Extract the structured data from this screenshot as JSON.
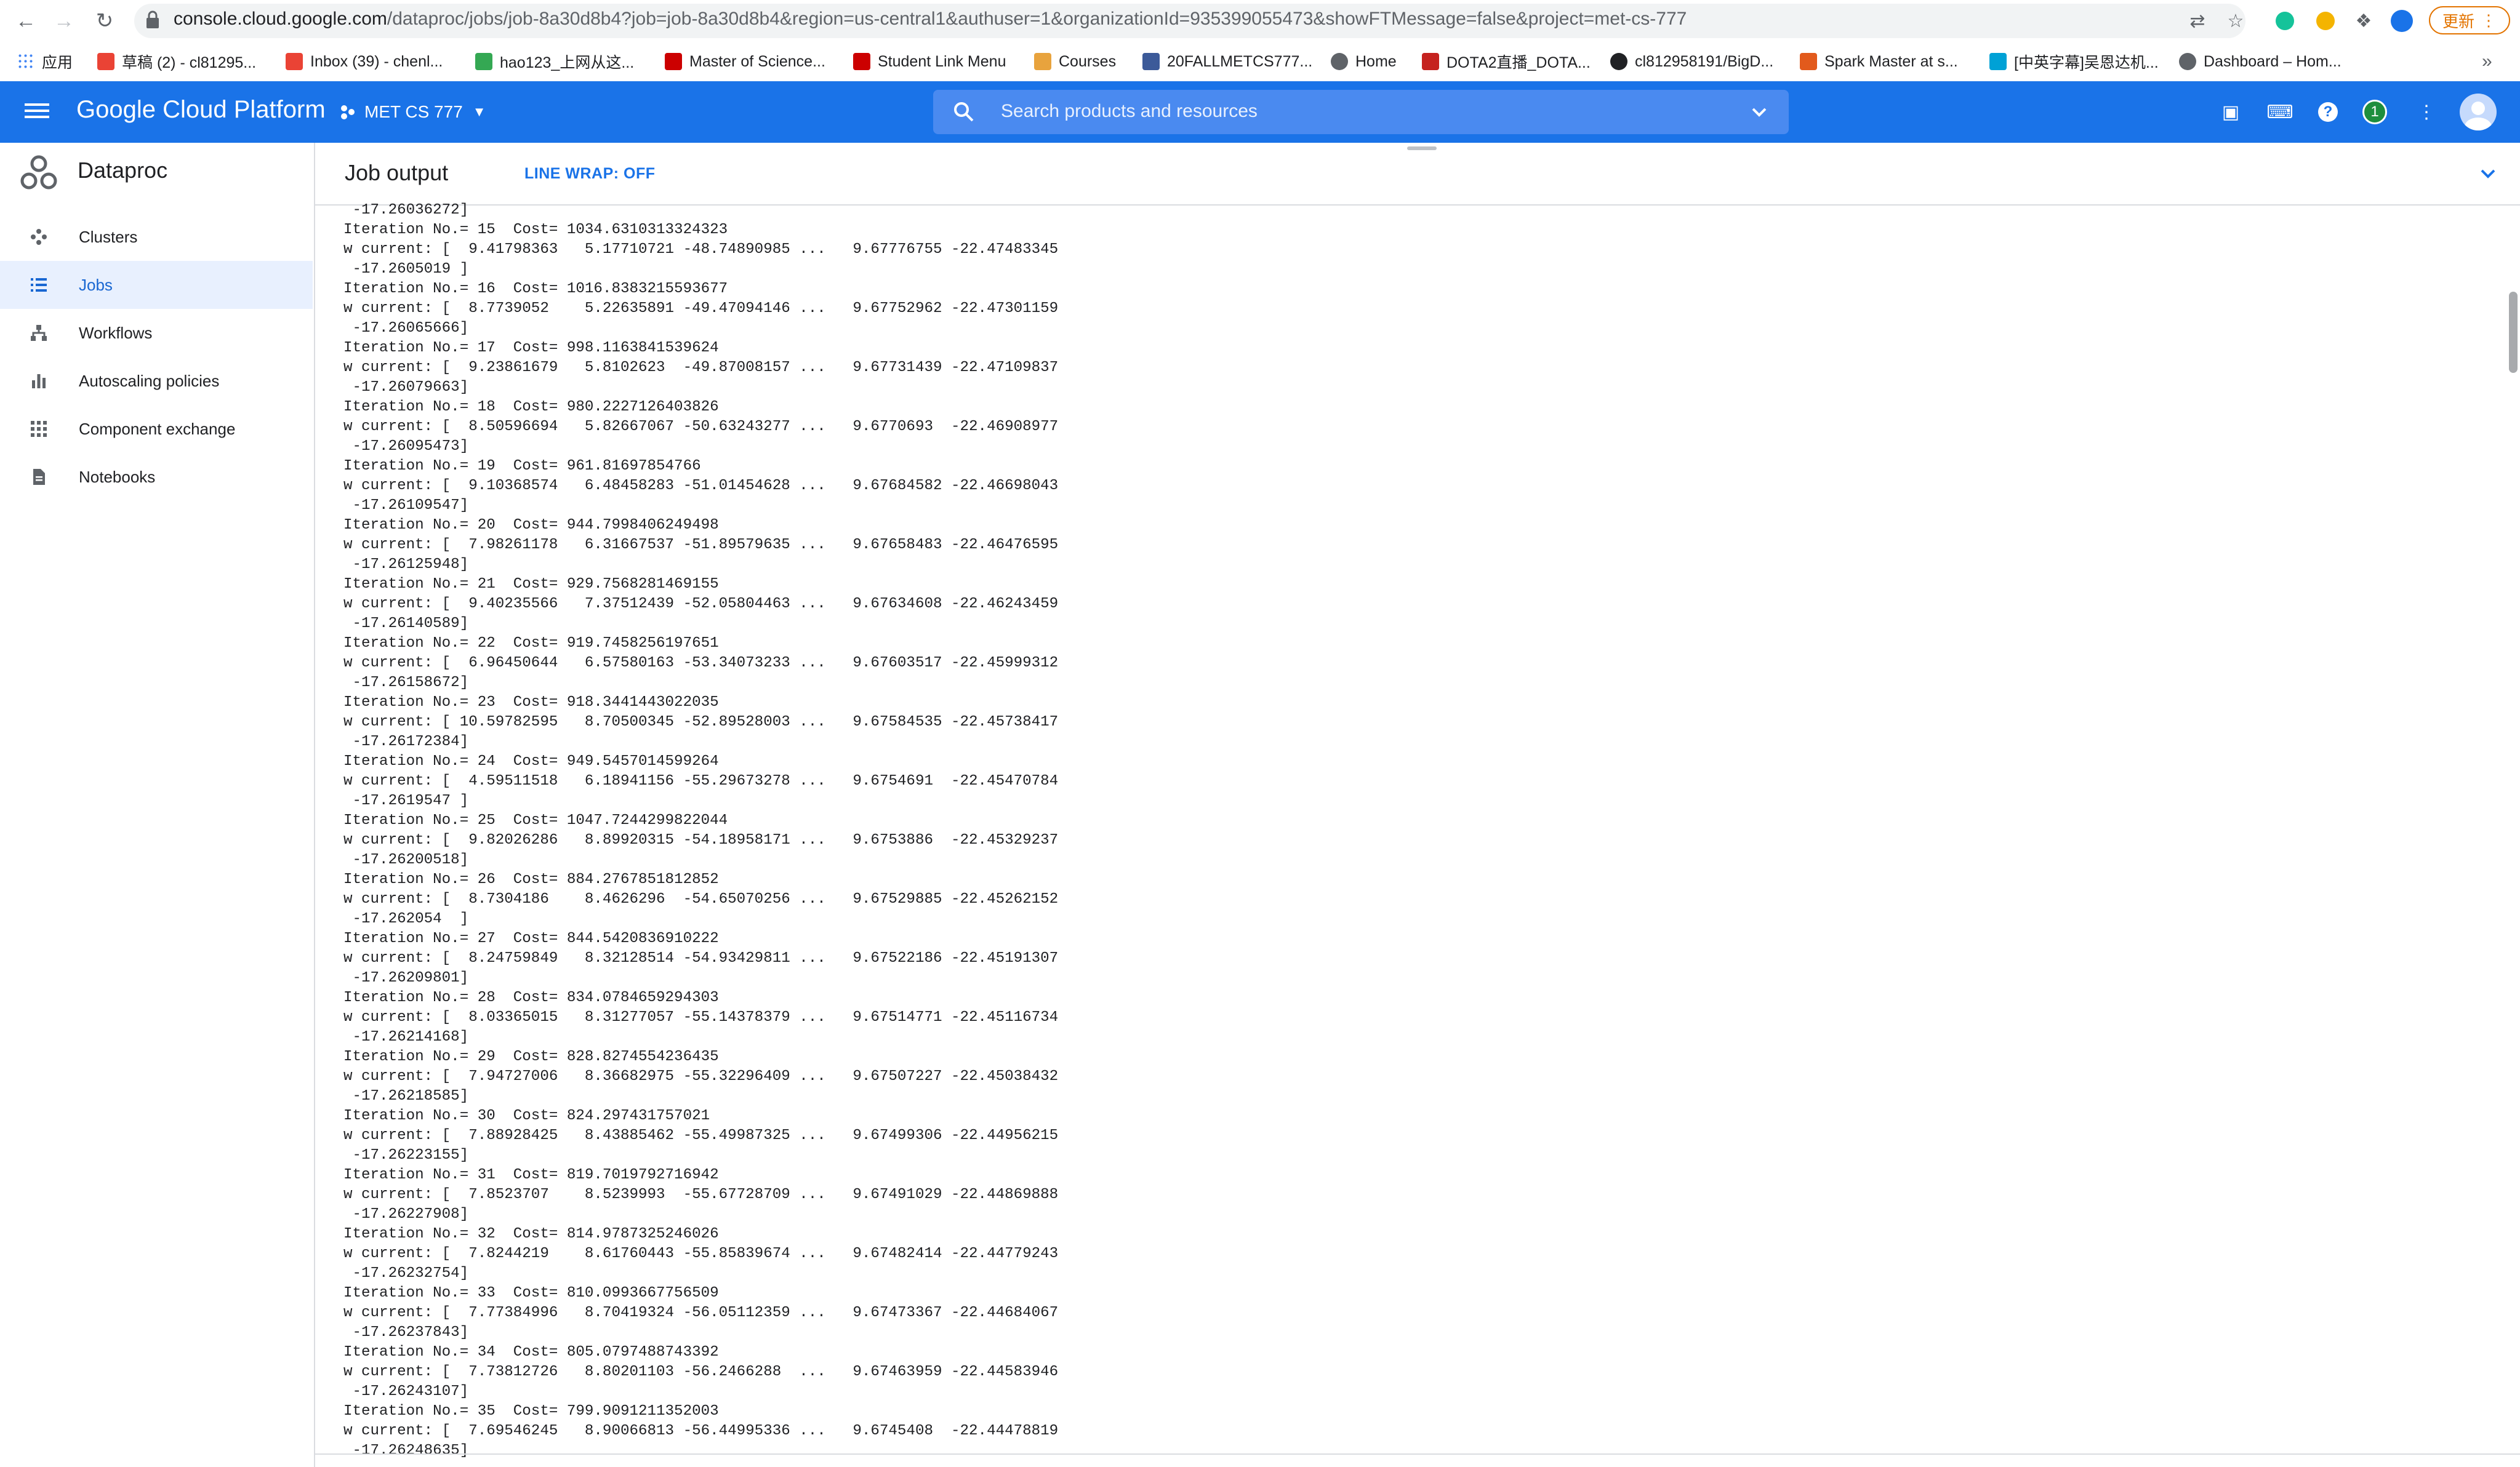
{
  "browser": {
    "url_host": "console.cloud.google.com",
    "url_rest": "/dataproc/jobs/job-8a30d8b4?job=job-8a30d8b4&region=us-central1&authuser=1&organizationId=935399055473&showFTMessage=false&project=met-cs-777",
    "update_label": "更新"
  },
  "bookmarks": [
    {
      "label": "应用",
      "color": "#4285f4"
    },
    {
      "label": "草稿 (2) - cl81295...",
      "color": "#ea4335"
    },
    {
      "label": "Inbox (39) - chenl...",
      "color": "#ea4335"
    },
    {
      "label": "hao123_上网从这...",
      "color": "#34a853"
    },
    {
      "label": "Master of Science...",
      "color": "#cc0000"
    },
    {
      "label": "Student Link Menu",
      "color": "#cc0000"
    },
    {
      "label": "Courses",
      "color": "#e8a33d"
    },
    {
      "label": "20FALLMETCS777...",
      "color": "#3c5a99"
    },
    {
      "label": "Home",
      "color": "#5f6368"
    },
    {
      "label": "DOTA2直播_DOTA...",
      "color": "#c5221f"
    },
    {
      "label": "cl812958191/BigD...",
      "color": "#202124"
    },
    {
      "label": "Spark Master at s...",
      "color": "#e25a1c"
    },
    {
      "label": "[中英字幕]吴恩达机...",
      "color": "#00a1d6"
    },
    {
      "label": "Dashboard – Hom...",
      "color": "#5f6368"
    }
  ],
  "header": {
    "title": "Google Cloud Platform",
    "project": "MET CS 777",
    "search_placeholder": "Search products and resources",
    "notifications": "1"
  },
  "sidebar": {
    "product": "Dataproc",
    "items": [
      {
        "label": "Clusters",
        "icon": "clusters-icon"
      },
      {
        "label": "Jobs",
        "icon": "jobs-icon"
      },
      {
        "label": "Workflows",
        "icon": "workflows-icon"
      },
      {
        "label": "Autoscaling policies",
        "icon": "autoscaling-icon"
      },
      {
        "label": "Component exchange",
        "icon": "component-exchange-icon"
      },
      {
        "label": "Notebooks",
        "icon": "notebooks-icon"
      }
    ]
  },
  "job_output": {
    "title": "Job output",
    "line_wrap": "LINE WRAP: OFF",
    "log_lines": [
      " -17.26036272]",
      "Iteration No.= 15  Cost= 1034.6310313324323",
      "w current: [  9.41798363   5.17710721 -48.74890985 ...   9.67776755 -22.47483345",
      " -17.2605019 ]",
      "Iteration No.= 16  Cost= 1016.8383215593677",
      "w current: [  8.7739052    5.22635891 -49.47094146 ...   9.67752962 -22.47301159",
      " -17.26065666]",
      "Iteration No.= 17  Cost= 998.1163841539624",
      "w current: [  9.23861679   5.8102623  -49.87008157 ...   9.67731439 -22.47109837",
      " -17.26079663]",
      "Iteration No.= 18  Cost= 980.2227126403826",
      "w current: [  8.50596694   5.82667067 -50.63243277 ...   9.6770693  -22.46908977",
      " -17.26095473]",
      "Iteration No.= 19  Cost= 961.81697854766",
      "w current: [  9.10368574   6.48458283 -51.01454628 ...   9.67684582 -22.46698043",
      " -17.26109547]",
      "Iteration No.= 20  Cost= 944.7998406249498",
      "w current: [  7.98261178   6.31667537 -51.89579635 ...   9.67658483 -22.46476595",
      " -17.26125948]",
      "Iteration No.= 21  Cost= 929.7568281469155",
      "w current: [  9.40235566   7.37512439 -52.05804463 ...   9.67634608 -22.46243459",
      " -17.26140589]",
      "Iteration No.= 22  Cost= 919.7458256197651",
      "w current: [  6.96450644   6.57580163 -53.34073233 ...   9.67603517 -22.45999312",
      " -17.26158672]",
      "Iteration No.= 23  Cost= 918.3441443022035",
      "w current: [ 10.59782595   8.70500345 -52.89528003 ...   9.67584535 -22.45738417",
      " -17.26172384]",
      "Iteration No.= 24  Cost= 949.5457014599264",
      "w current: [  4.59511518   6.18941156 -55.29673278 ...   9.6754691  -22.45470784",
      " -17.2619547 ]",
      "Iteration No.= 25  Cost= 1047.7244299822044",
      "w current: [  9.82026286   8.89920315 -54.18958171 ...   9.6753886  -22.45329237",
      " -17.26200518]",
      "Iteration No.= 26  Cost= 884.2767851812852",
      "w current: [  8.7304186    8.4626296  -54.65070256 ...   9.67529885 -22.45262152",
      " -17.262054  ]",
      "Iteration No.= 27  Cost= 844.5420836910222",
      "w current: [  8.24759849   8.32128514 -54.93429811 ...   9.67522186 -22.45191307",
      " -17.26209801]",
      "Iteration No.= 28  Cost= 834.0784659294303",
      "w current: [  8.03365015   8.31277057 -55.14378379 ...   9.67514771 -22.45116734",
      " -17.26214168]",
      "Iteration No.= 29  Cost= 828.8274554236435",
      "w current: [  7.94727006   8.36682975 -55.32296409 ...   9.67507227 -22.45038432",
      " -17.26218585]",
      "Iteration No.= 30  Cost= 824.297431757021",
      "w current: [  7.88928425   8.43885462 -55.49987325 ...   9.67499306 -22.44956215",
      " -17.26223155]",
      "Iteration No.= 31  Cost= 819.7019792716942",
      "w current: [  7.8523707    8.5239993  -55.67728709 ...   9.67491029 -22.44869888",
      " -17.26227908]",
      "Iteration No.= 32  Cost= 814.9787325246026",
      "w current: [  7.8244219    8.61760443 -55.85839674 ...   9.67482414 -22.44779243",
      " -17.26232754]",
      "Iteration No.= 33  Cost= 810.0993667756509",
      "w current: [  7.77384996   8.70419324 -56.05112359 ...   9.67473367 -22.44684067",
      " -17.26237843]",
      "Iteration No.= 34  Cost= 805.0797488743392",
      "w current: [  7.73812726   8.80201103 -56.2466288  ...   9.67463959 -22.44583946",
      " -17.26243107]",
      "Iteration No.= 35  Cost= 799.9091211352003",
      "w current: [  7.69546245   8.90066813 -56.44995336 ...   9.6745408  -22.44478819",
      " -17.26248635]"
    ]
  }
}
